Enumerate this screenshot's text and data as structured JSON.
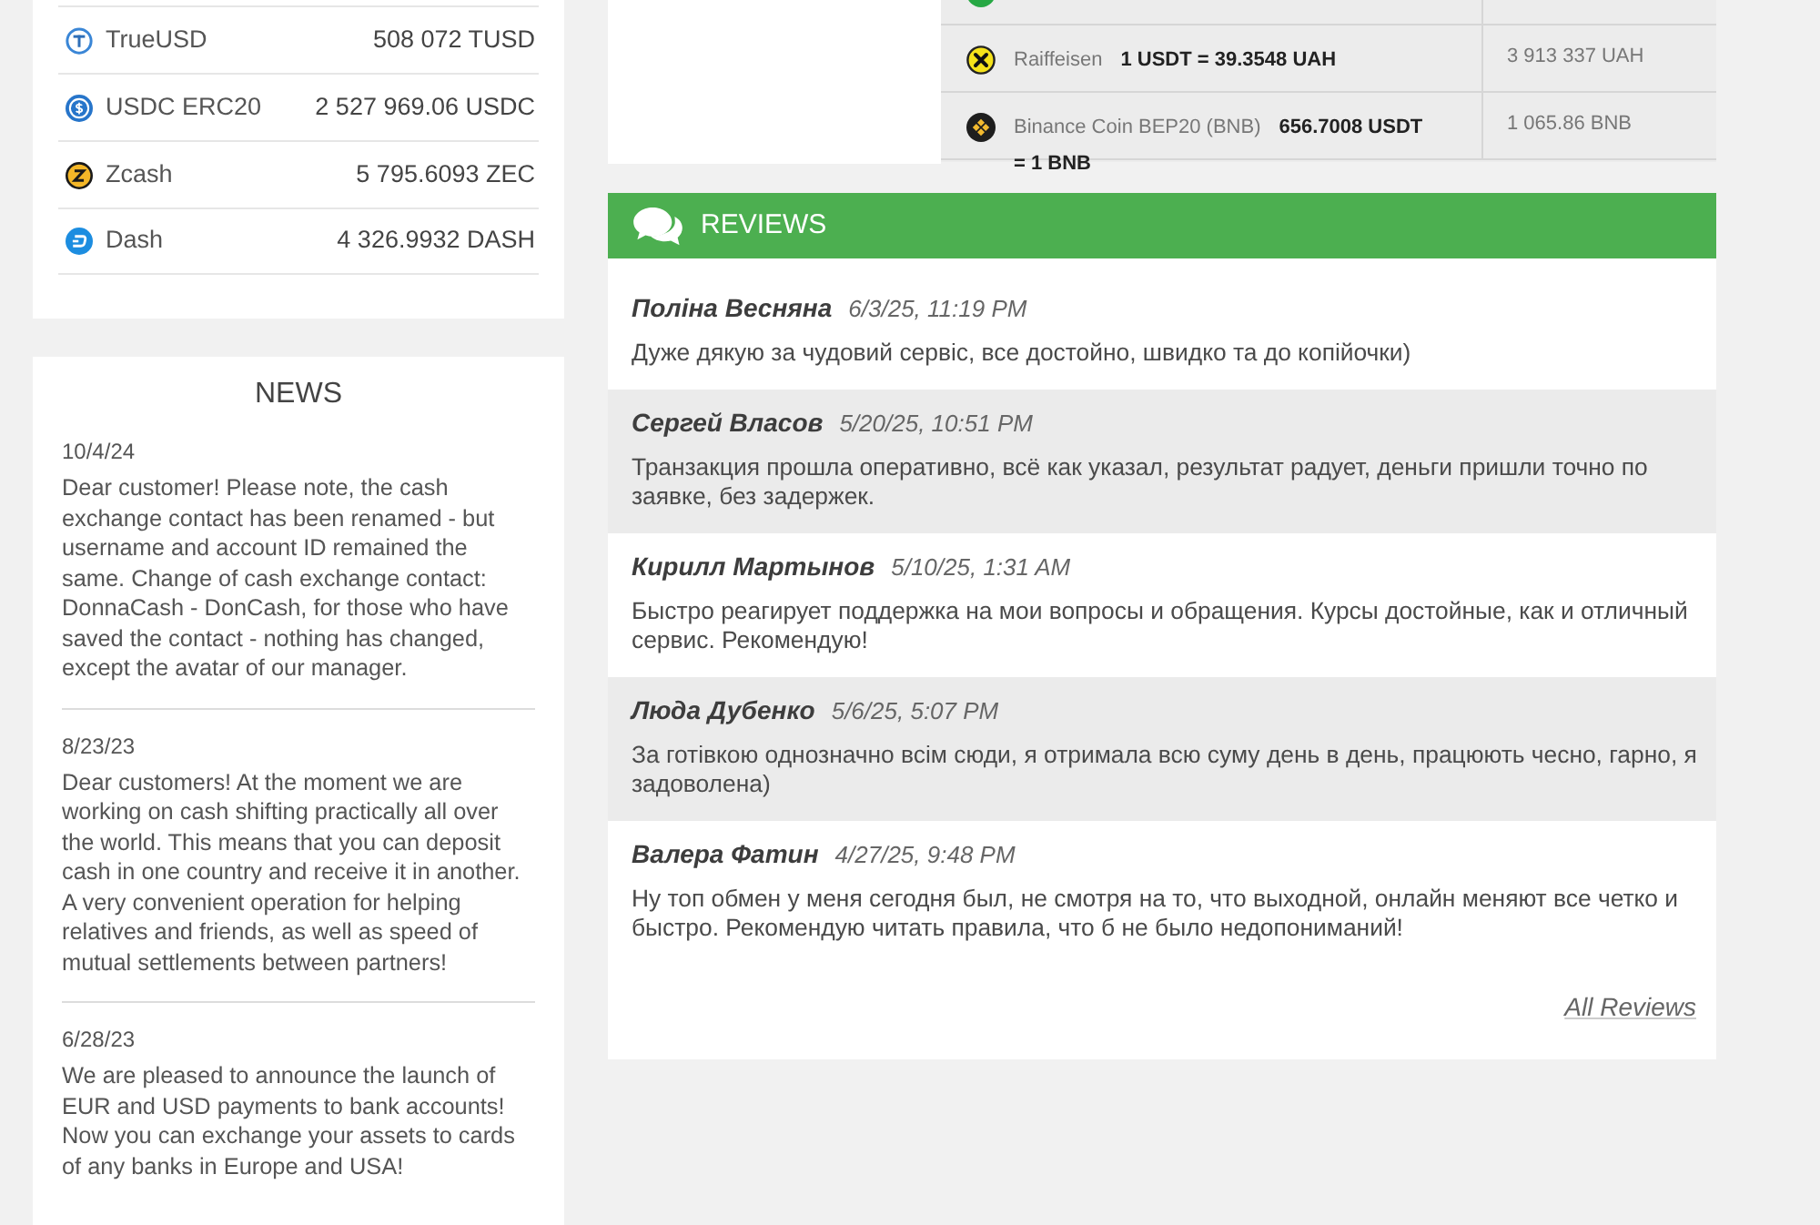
{
  "reserves": [
    {
      "name": "TrueUSD",
      "amount": "508 072 TUSD"
    },
    {
      "name": "USDC ERC20",
      "amount": "2 527 969.06 USDC"
    },
    {
      "name": "Zcash",
      "amount": "5 795.6093 ZEC"
    },
    {
      "name": "Dash",
      "amount": "4 326.9932 DASH"
    }
  ],
  "news": {
    "title": "NEWS",
    "items": [
      {
        "date": "10/4/24",
        "text": "Dear customer! Please note, the cash exchange contact has been renamed - but username and account ID remained the same. Change of cash exchange contact: DonnaCash - DonCash, for those who have saved the contact - nothing has changed, except the avatar of our manager."
      },
      {
        "date": "8/23/23",
        "text": "Dear customers! At the moment we are working on cash shifting practically all over the world. This means that you can deposit cash in one country and receive it in another. A very convenient operation for helping relatives and friends, as well as speed of mutual settlements between partners!"
      },
      {
        "date": "6/28/23",
        "text": "We are pleased to announce the launch of EUR and USD payments to bank accounts! Now you can exchange your assets to cards of any banks in Europe and USA!"
      }
    ]
  },
  "rates": [
    {
      "name": "Raiffeisen",
      "rate": "1 USDT = 39.3548 UAH",
      "reserve": "3 913 337 UAH"
    },
    {
      "name": "Binance Coin BEP20 (BNB)",
      "rate": "656.7008 USDT = 1 BNB",
      "reserve": "1 065.86 BNB"
    }
  ],
  "reviews": {
    "title": "REVIEWS",
    "items": [
      {
        "name": "Поліна Весняна",
        "date": "6/3/25, 11:19 PM",
        "text": "Дуже дякую за чудовий сервіс, все достойно, швидко та до копійочки)"
      },
      {
        "name": "Сергей Власов",
        "date": "5/20/25, 10:51 PM",
        "text": "Транзакция прошла оперативно, всё как указал, результат радует, деньги пришли точно по заявке, без задержек."
      },
      {
        "name": "Кирилл Мартынов",
        "date": "5/10/25, 1:31 AM",
        "text": "Быстро реагирует поддержка на мои вопросы и обращения. Курсы достойные, как и отличный сервис. Рекомендую!"
      },
      {
        "name": "Люда Дубенко",
        "date": "5/6/25, 5:07 PM",
        "text": "За готівкою однозначно всім сюди, я отримала всю суму день в день, працюють чесно, гарно, я задоволена)"
      },
      {
        "name": "Валера Фатин",
        "date": "4/27/25, 9:48 PM",
        "text": "Ну топ обмен у меня сегодня был, не смотря на то, что выходной, онлайн меняют все четко и быстро. Рекомендую читать правила, что б не было недопониманий!"
      }
    ],
    "all_link": "All Reviews"
  }
}
